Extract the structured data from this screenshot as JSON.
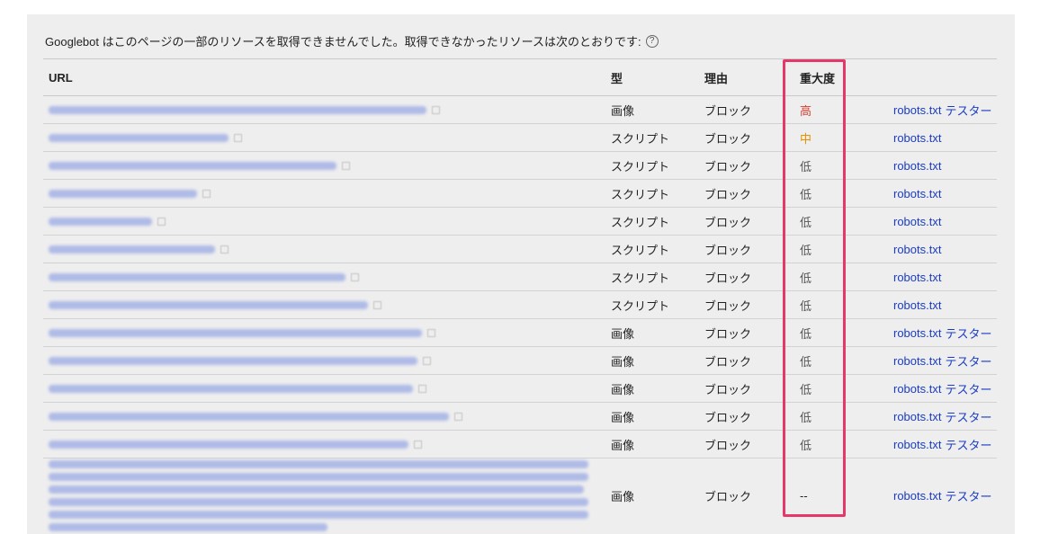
{
  "intro_text": "Googlebot はこのページの一部のリソースを取得できませんでした。取得できなかったリソースは次のとおりです:",
  "help_glyph": "?",
  "columns": {
    "url": "URL",
    "type": "型",
    "reason": "理由",
    "severity": "重大度"
  },
  "rows": [
    {
      "type": "画像",
      "reason": "ブロック",
      "severity": "高",
      "sev_class": "high",
      "link1": "robots.txt",
      "link2": "テスター"
    },
    {
      "type": "スクリプト",
      "reason": "ブロック",
      "severity": "中",
      "sev_class": "mid",
      "link1": "robots.txt",
      "link2": ""
    },
    {
      "type": "スクリプト",
      "reason": "ブロック",
      "severity": "低",
      "sev_class": "low",
      "link1": "robots.txt",
      "link2": ""
    },
    {
      "type": "スクリプト",
      "reason": "ブロック",
      "severity": "低",
      "sev_class": "low",
      "link1": "robots.txt",
      "link2": ""
    },
    {
      "type": "スクリプト",
      "reason": "ブロック",
      "severity": "低",
      "sev_class": "low",
      "link1": "robots.txt",
      "link2": ""
    },
    {
      "type": "スクリプト",
      "reason": "ブロック",
      "severity": "低",
      "sev_class": "low",
      "link1": "robots.txt",
      "link2": ""
    },
    {
      "type": "スクリプト",
      "reason": "ブロック",
      "severity": "低",
      "sev_class": "low",
      "link1": "robots.txt",
      "link2": ""
    },
    {
      "type": "スクリプト",
      "reason": "ブロック",
      "severity": "低",
      "sev_class": "low",
      "link1": "robots.txt",
      "link2": ""
    },
    {
      "type": "画像",
      "reason": "ブロック",
      "severity": "低",
      "sev_class": "low",
      "link1": "robots.txt",
      "link2": "テスター"
    },
    {
      "type": "画像",
      "reason": "ブロック",
      "severity": "低",
      "sev_class": "low",
      "link1": "robots.txt",
      "link2": "テスター"
    },
    {
      "type": "画像",
      "reason": "ブロック",
      "severity": "低",
      "sev_class": "low",
      "link1": "robots.txt",
      "link2": "テスター"
    },
    {
      "type": "画像",
      "reason": "ブロック",
      "severity": "低",
      "sev_class": "low",
      "link1": "robots.txt",
      "link2": "テスター"
    },
    {
      "type": "画像",
      "reason": "ブロック",
      "severity": "低",
      "sev_class": "low",
      "link1": "robots.txt",
      "link2": "テスター"
    },
    {
      "type": "画像",
      "reason": "ブロック",
      "severity": "--",
      "sev_class": "none",
      "link1": "robots.txt",
      "link2": "テスター"
    }
  ],
  "colors": {
    "link": "#1a3cc4",
    "severity_high": "#d23f31",
    "severity_mid": "#e59100",
    "highlight_border": "#e6376b"
  }
}
